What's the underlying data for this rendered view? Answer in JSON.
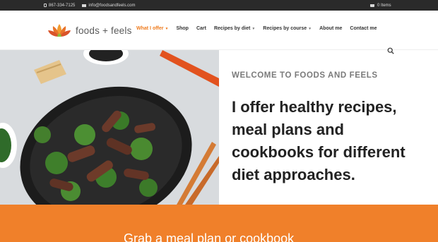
{
  "topbar": {
    "phone": "867-334-7125",
    "email": "info@foodsandfeels.com",
    "cart": "0 Items"
  },
  "header": {
    "brand": "foods + feels",
    "nav": [
      {
        "label": "What I offer",
        "active": true,
        "dropdown": true
      },
      {
        "label": "Shop",
        "active": false,
        "dropdown": false
      },
      {
        "label": "Cart",
        "active": false,
        "dropdown": false
      },
      {
        "label": "Recipes by diet",
        "active": false,
        "dropdown": true
      },
      {
        "label": "Recipes by course",
        "active": false,
        "dropdown": true
      },
      {
        "label": "About me",
        "active": false,
        "dropdown": false
      },
      {
        "label": "Contact me",
        "active": false,
        "dropdown": false
      }
    ]
  },
  "hero": {
    "welcome": "WELCOME TO FOODS AND FEELS",
    "headline": "I offer healthy recipes, meal plans and cookbooks for different diet approaches."
  },
  "band": {
    "cta": "Grab a meal plan or cookbook"
  },
  "colors": {
    "accent": "#ef7b1d",
    "band": "#f0802a",
    "topbar": "#2a2a2a"
  }
}
